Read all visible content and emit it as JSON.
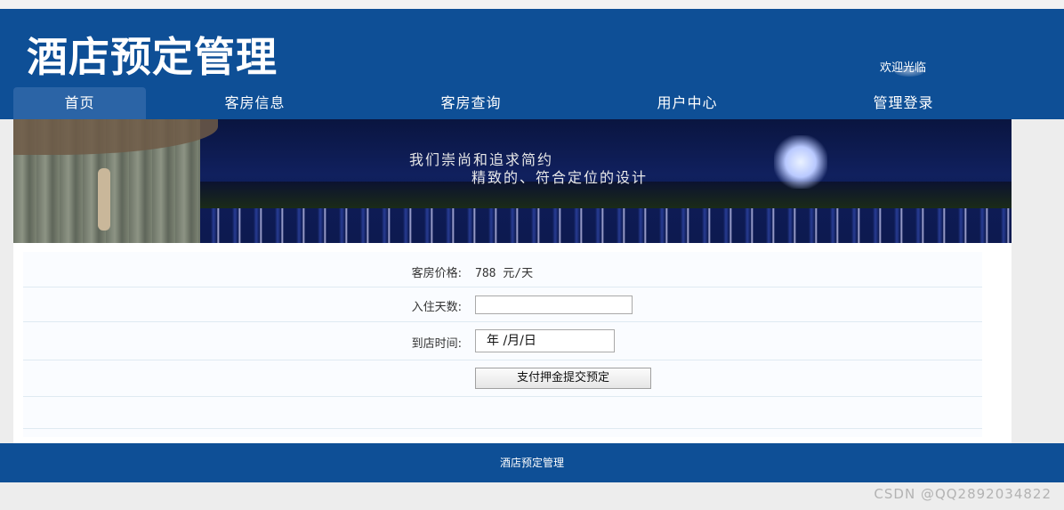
{
  "header": {
    "site_title": "酒店预定管理",
    "welcome": "欢迎光临"
  },
  "nav": {
    "items": [
      {
        "label": "首页",
        "active": true
      },
      {
        "label": "客房信息",
        "active": false
      },
      {
        "label": "客房查询",
        "active": false
      },
      {
        "label": "用户中心",
        "active": false
      },
      {
        "label": "管理登录",
        "active": false
      }
    ]
  },
  "banner": {
    "line1": "我们崇尚和追求简约",
    "line2": "精致的、符合定位的设计"
  },
  "form": {
    "price_label": "客房价格:",
    "price_value": "788 元/天",
    "days_label": "入住天数:",
    "days_value": "",
    "date_label": "到店时间:",
    "date_placeholder": "年 /月/日",
    "submit_label": "支付押金提交预定"
  },
  "footer": {
    "text": "酒店预定管理"
  },
  "watermark": "CSDN @QQ2892034822",
  "colors": {
    "primary": "#0e4f96",
    "nav_active": "#2b64a6"
  }
}
